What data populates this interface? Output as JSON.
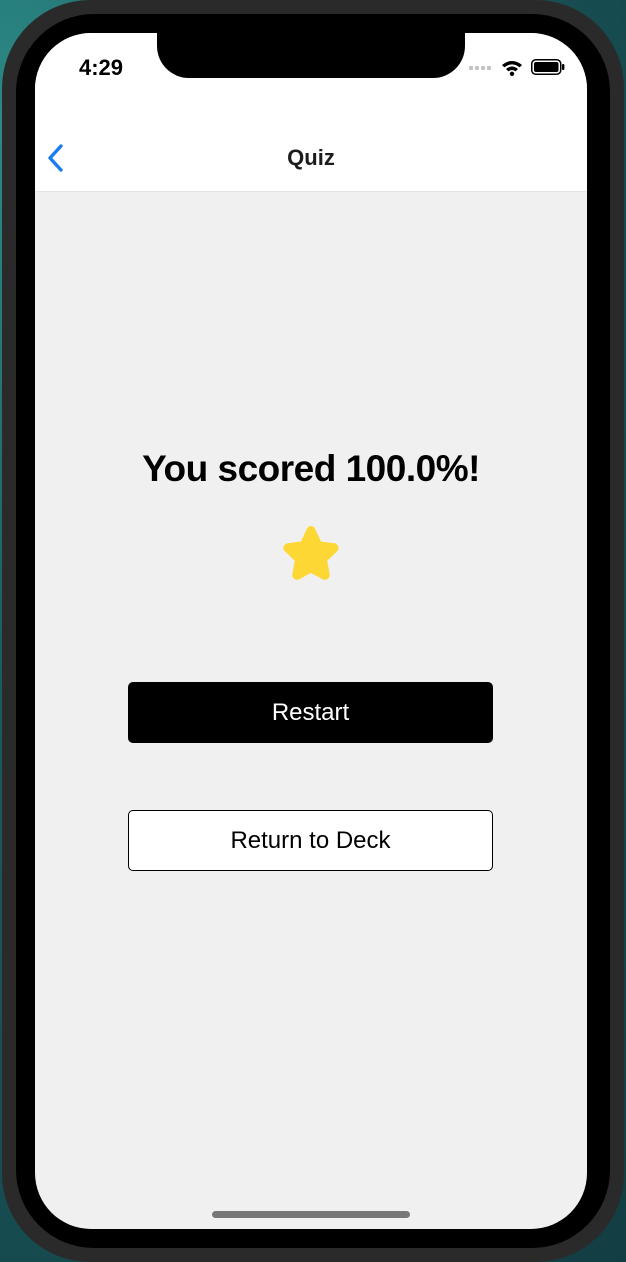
{
  "status_bar": {
    "time": "4:29",
    "icons": [
      "signal-icon",
      "wifi-icon",
      "battery-icon"
    ]
  },
  "nav": {
    "title": "Quiz",
    "back_icon": "chevron-left-icon",
    "accent_color": "#1a7cf3"
  },
  "result": {
    "score_text": "You scored 100.0%!",
    "icon": "star-icon",
    "star_color": "#fdd835"
  },
  "actions": {
    "restart_label": "Restart",
    "return_label": "Return to Deck"
  }
}
